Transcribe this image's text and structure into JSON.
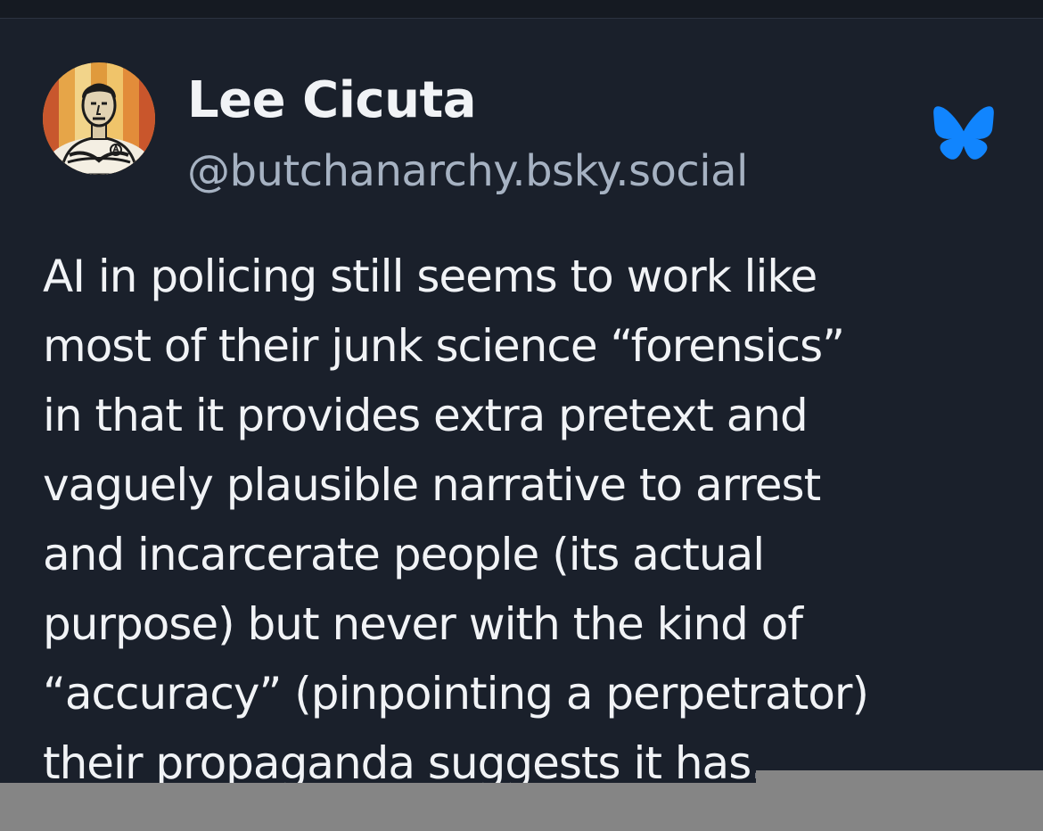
{
  "post": {
    "author": {
      "display_name": "Lee Cicuta",
      "handle": "@butchanarchy.bsky.social",
      "avatar": "portrait-avatar"
    },
    "platform_icon": "bluesky-butterfly-icon",
    "text_lines": [
      "AI in policing still seems to work like",
      "most of their junk science “forensics”",
      "in that it provides extra pretext and",
      "vaguely plausible narrative to arrest",
      "and incarcerate people (its actual",
      "purpose) but never with the kind of",
      "“accuracy” (pinpointing a perpetrator)",
      "their propaganda suggests it has."
    ]
  },
  "colors": {
    "background": "#1a202b",
    "text": "#f1f3f6",
    "handle": "#a6b2c2",
    "bluesky_blue": "#1185fe"
  }
}
